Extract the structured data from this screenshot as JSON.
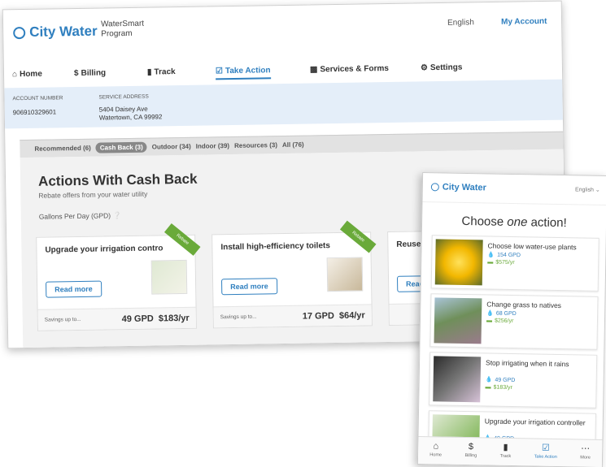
{
  "desktop": {
    "brand": "City Water",
    "program": [
      "WaterSmart",
      "Program"
    ],
    "language": "English",
    "my_account": "My Account",
    "nav": [
      {
        "label": "Home",
        "icon": "home-icon"
      },
      {
        "label": "Billing",
        "icon": "dollar-icon"
      },
      {
        "label": "Track",
        "icon": "bar-chart-icon"
      },
      {
        "label": "Take Action",
        "icon": "checkbox-icon",
        "active": true
      },
      {
        "label": "Services & Forms",
        "icon": "list-icon"
      },
      {
        "label": "Settings",
        "icon": "gear-icon"
      }
    ],
    "account": {
      "number_label": "ACCOUNT NUMBER",
      "number": "906910329601",
      "address_label": "SERVICE ADDRESS",
      "address_line1": "5404 Daisey Ave",
      "address_line2": "Watertown, CA 99992"
    },
    "filters": [
      {
        "label": "Recommended (6)"
      },
      {
        "label": "Cash Back (3)",
        "active": true
      },
      {
        "label": "Outdoor (34)"
      },
      {
        "label": "Indoor (39)"
      },
      {
        "label": "Resources (3)"
      },
      {
        "label": "All (76)"
      }
    ],
    "heading": "Actions With Cash Back",
    "subheading": "Rebate offers from your water utility",
    "gpd_label": "Gallons Per Day (GPD)",
    "cards": [
      {
        "title": "Upgrade your irrigation contro",
        "ribbon": "Rebate",
        "read_more": "Read more",
        "savings_label": "Savings up to...",
        "gpd": "49 GPD",
        "money": "$183/yr"
      },
      {
        "title": "Install high-efficiency toilets",
        "ribbon": "Rebate",
        "read_more": "Read more",
        "savings_label": "Savings up to...",
        "gpd": "17 GPD",
        "money": "$64/yr"
      },
      {
        "title": "Reuse y",
        "ribbon": "",
        "read_more": "Read",
        "savings_label": "",
        "gpd": "",
        "money": ""
      }
    ]
  },
  "mobile": {
    "brand": "City Water",
    "language": "English",
    "heading_pre": "Choose ",
    "heading_em": "one",
    "heading_post": " action!",
    "actions": [
      {
        "title": "Choose low water-use plants",
        "gpd": "154 GPD",
        "money": "$575/yr"
      },
      {
        "title": "Change grass to natives",
        "gpd": "68 GPD",
        "money": "$256/yr"
      },
      {
        "title": "Stop irrigating when it rains",
        "gpd": "49 GPD",
        "money": "$183/yr"
      },
      {
        "title": "Upgrade your irrigation controller",
        "gpd": "49 GPD",
        "money": ""
      }
    ],
    "tabs": [
      {
        "label": "Home",
        "icon": "home-icon"
      },
      {
        "label": "Billing",
        "icon": "dollar-icon"
      },
      {
        "label": "Track",
        "icon": "bar-chart-icon"
      },
      {
        "label": "Take Action",
        "icon": "checkbox-icon",
        "active": true
      },
      {
        "label": "More",
        "icon": "more-icon"
      }
    ]
  }
}
